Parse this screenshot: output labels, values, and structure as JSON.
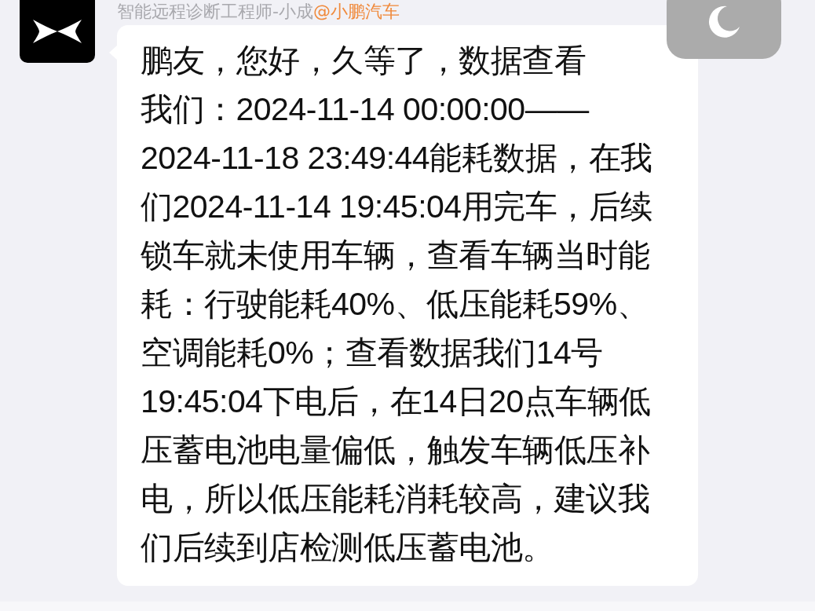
{
  "sender": {
    "name": "智能远程诊断工程师-小成",
    "mention": "@小鹏汽车"
  },
  "message": {
    "lines": [
      "鹏友，您好，久等了，数据查看",
      "我们：2024-11-14 00:00:00——",
      "2024-11-18 23:49:44能耗数据，在我",
      "们2024-11-14 19:45:04用完车，后续",
      "锁车就未使用车辆，查看车辆当时能",
      "耗：行驶能耗40%、低压能耗59%、",
      "空调能耗0%；查看数据我们14号",
      "19:45:04下电后，在14日20点车辆低",
      "压蓄电池电量偏低，触发车辆低压补",
      "电，所以低压能耗消耗较高，建议我",
      "们后续到店检测低压蓄电池。"
    ]
  },
  "dark_mode_button": {
    "on": false
  }
}
